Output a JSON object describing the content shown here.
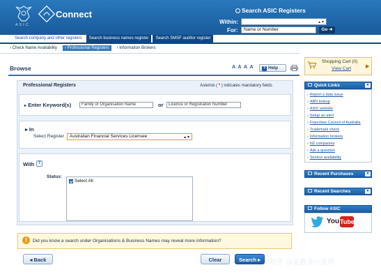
{
  "header": {
    "crest_text": "A S I C",
    "brand": "Connect",
    "search_title": "Search ASIC Registers",
    "within_label": "Within:",
    "within_value": "",
    "for_label": "For:",
    "for_placeholder": "Name or Number",
    "go_label": "Go"
  },
  "tabs": [
    {
      "label": "Search company and other registers",
      "active": true
    },
    {
      "label": "Search business names register",
      "active": false
    },
    {
      "label": "Search SMSF auditor register",
      "active": false
    }
  ],
  "subnav": [
    {
      "label": "› Check Name Availability",
      "active": false
    },
    {
      "label": "› Professional Registers",
      "active": true
    },
    {
      "label": "› Information Brokers",
      "active": false
    }
  ],
  "toolbar": {
    "browse": "Browse",
    "font_sizes": "A A A A",
    "help_label": "Help"
  },
  "form": {
    "title": "Professional Registers",
    "mandatory_prefix": "Asterisk (",
    "mandatory_star": "*",
    "mandatory_suffix": ") indicates mandatory fields",
    "keyword_label": "Enter Keyword(s)",
    "keyword_placeholder_1": "Family or Organisation Name",
    "or_label": "or",
    "keyword_placeholder_2": "Licence or Registration Number",
    "in_label": "In",
    "register_label": "Select Register",
    "register_value": "Australian Financial Services Licensee",
    "with_label": "With",
    "status_label": "Status:",
    "status_option": "Select All",
    "notice": "Did you know a search under Organisations & Business Names may reveal more information?",
    "back_label": "Back",
    "clear_label": "Clear",
    "search_label": "Search"
  },
  "sidebar": {
    "cart_title": "Shopping Cart (0)",
    "cart_link": "View Cart",
    "quick_links_title": "Quick Links",
    "quick_links": [
      "Report a data issue",
      "ABN lookup",
      "ASIC website",
      "Setup an alert",
      "Franchise Council of Australia",
      "Trademark check",
      "Information brokers",
      "NZ companies",
      "Ask a question",
      "Service availability"
    ],
    "recent_purchases": "Recent Purchases",
    "recent_searches": "Recent Searches",
    "follow": "Follow ASIC",
    "youtube_you": "You",
    "youtube_tube": "Tube"
  },
  "watermark": "知乎 @证券法小法师",
  "colors": {
    "header_blue": "#1f67aa",
    "tab_dark": "#0e4784",
    "link_blue": "#1b56a0",
    "search_btn": "#1b5ea8",
    "notice_bg": "#fff8e0",
    "mandatory_red": "#d11111"
  }
}
